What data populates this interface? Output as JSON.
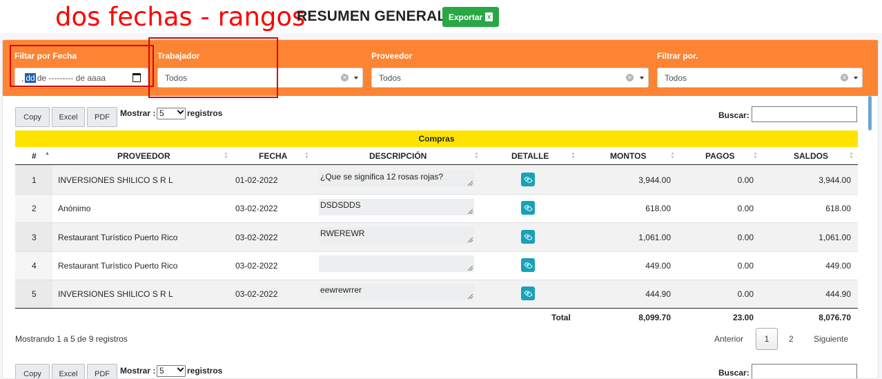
{
  "annotation": "dos fechas - rangos",
  "header": {
    "title": "RESUMEN GENERAL",
    "export_label": "Exportar",
    "export_icon": "excel-icon"
  },
  "filters": {
    "date": {
      "label": "Filtar por Fecha",
      "value_prefix": ",",
      "value_dd": "dd",
      "value_rest": "de --------- de aaaa"
    },
    "trabajador": {
      "label": "Trabajador",
      "value": "Todos"
    },
    "proveedor": {
      "label": "Proveedor",
      "value": "Todos"
    },
    "filtrar": {
      "label": "Filtrar por.",
      "value": "Todos"
    }
  },
  "buttons": {
    "copy": "Copy",
    "excel": "Excel",
    "pdf": "PDF"
  },
  "length": {
    "label": "Mostrar :",
    "value": "5",
    "suffix": "registros"
  },
  "search": {
    "label": "Buscar:"
  },
  "table": {
    "caption": "Compras",
    "columns": [
      "#",
      "PROVEEDOR",
      "FECHA",
      "DESCRIPCIÓN",
      "DETALLE",
      "MONTOS",
      "PAGOS",
      "SALDOS"
    ],
    "rows": [
      {
        "n": "1",
        "proveedor": "INVERSIONES SHILICO S R L",
        "fecha": "01-02-2022",
        "descripcion": "¿Que se significa 12 rosas rojas?",
        "montos": "3,944.00",
        "pagos": "0.00",
        "saldos": "3,944.00"
      },
      {
        "n": "2",
        "proveedor": "Anónimo",
        "fecha": "03-02-2022",
        "descripcion": "DSDSDDS",
        "montos": "618.00",
        "pagos": "0.00",
        "saldos": "618.00"
      },
      {
        "n": "3",
        "proveedor": "Restaurant Turístico Puerto Rico",
        "fecha": "03-02-2022",
        "descripcion": "RWEREWR",
        "montos": "1,061.00",
        "pagos": "0.00",
        "saldos": "1,061.00"
      },
      {
        "n": "4",
        "proveedor": "Restaurant Turístico Puerto Rico",
        "fecha": "03-02-2022",
        "descripcion": "",
        "montos": "449.00",
        "pagos": "0.00",
        "saldos": "449.00"
      },
      {
        "n": "5",
        "proveedor": "INVERSIONES SHILICO S R L",
        "fecha": "03-02-2022",
        "descripcion": "eewrewrrer",
        "montos": "444.90",
        "pagos": "0.00",
        "saldos": "444.90"
      }
    ],
    "footer": {
      "label": "Total",
      "montos": "8,099.70",
      "pagos": "23.00",
      "saldos": "8,076.70"
    }
  },
  "info": "Mostrando 1 a 5 de 9 registros",
  "pagination": {
    "prev": "Anterior",
    "pages": [
      "1",
      "2"
    ],
    "active": "1",
    "next": "Siguiente"
  },
  "colors": {
    "filter_bar": "#fd8433",
    "caption_bar": "#ffe300",
    "export": "#28a745",
    "detail_button": "#17a2b8",
    "annotation": "#ff0000"
  }
}
